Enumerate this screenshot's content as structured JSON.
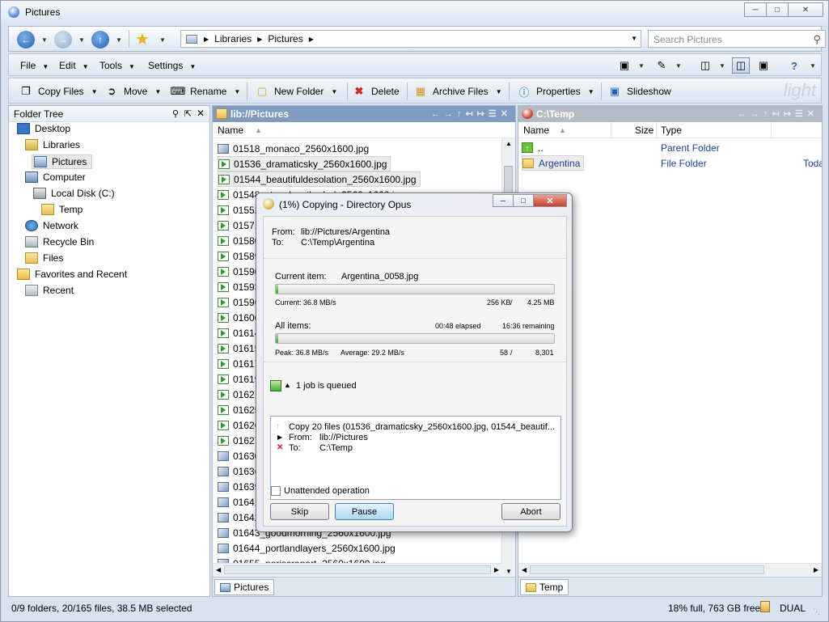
{
  "window": {
    "title": "Pictures"
  },
  "nav": {
    "breadcrumb": [
      "Libraries",
      "Pictures"
    ],
    "search_placeholder": "Search Pictures"
  },
  "menu": {
    "items": [
      "File",
      "Edit",
      "Tools",
      "Settings"
    ]
  },
  "toolbar": {
    "buttons": [
      "Copy Files",
      "Move",
      "Rename",
      "New Folder",
      "Delete",
      "Archive Files",
      "Properties",
      "Slideshow"
    ],
    "watermark": "light"
  },
  "tree": {
    "title": "Folder Tree",
    "items": [
      "Desktop",
      "Libraries",
      "Pictures",
      "Computer",
      "Local Disk (C:)",
      "Temp",
      "Network",
      "Recycle Bin",
      "Files",
      "Favorites and Recent",
      "Recent"
    ]
  },
  "left_lister": {
    "title": "lib://Pictures",
    "col_name": "Name",
    "files": [
      "01518_monaco_2560x1600.jpg",
      "01536_dramaticsky_2560x1600.jpg",
      "01544_beautifuldesolation_2560x1600.jpg",
      "01548_stpaulscathedral_2560x1600.jpg",
      "01552",
      "01571",
      "01580",
      "01589",
      "01590",
      "01593",
      "01596",
      "01600",
      "01614",
      "01615",
      "01617",
      "01619",
      "01621",
      "01625",
      "01626",
      "01627",
      "01630",
      "01636",
      "01639",
      "01641",
      "01642",
      "01643_goodmorning_2560x1600.jpg",
      "01644_portlandlayers_2560x1600.jpg",
      "01655_pariscrapart_2560x1600.jpg"
    ],
    "tab": "Pictures"
  },
  "right_lister": {
    "title": "C:\\Temp",
    "col_name": "Name",
    "col_size": "Size",
    "col_type": "Type",
    "rows": [
      {
        "name": "..",
        "type": "Parent Folder",
        "date": ""
      },
      {
        "name": "Argentina",
        "type": "File Folder",
        "date": "Toda"
      }
    ],
    "tab": "Temp"
  },
  "status": {
    "left": "0/9 folders, 20/165 files, 38.5 MB selected",
    "disk": "18% full, 763 GB free",
    "mode": "DUAL"
  },
  "dialog": {
    "title": "(1%) Copying - Directory Opus",
    "from_label": "From:",
    "from_value": "lib://Pictures/Argentina",
    "to_label": "To:",
    "to_value": "C:\\Temp\\Argentina",
    "current_item_label": "Current item:",
    "current_item_value": "Argentina_0058.jpg",
    "current_speed": "Current: 36.8 MB/s",
    "current_done": "256 KB",
    "current_slash": "/",
    "current_total": "4.25 MB",
    "current_progress": 0.01,
    "all_items_label": "All items:",
    "elapsed": "00:48 elapsed",
    "remaining": "16:36 remaining",
    "peak": "Peak: 36.8 MB/s",
    "average": "Average: 29.2 MB/s",
    "all_done": "58",
    "all_slash": "/",
    "all_total": "8,301",
    "all_progress": 0.01,
    "queue_text": "1 job is queued",
    "job_line": "Copy 20 files (01536_dramaticsky_2560x1600.jpg, 01544_beautif...",
    "job_from_label": "From:",
    "job_from_value": "lib://Pictures",
    "job_to_label": "To:",
    "job_to_value": "C:\\Temp",
    "unattended": "Unattended operation",
    "skip": "Skip",
    "pause": "Pause",
    "abort": "Abort"
  },
  "colors": {
    "accent_left": "#7f9bbf",
    "accent_right": "#b6bcc6",
    "progress": "#2fae2f"
  }
}
